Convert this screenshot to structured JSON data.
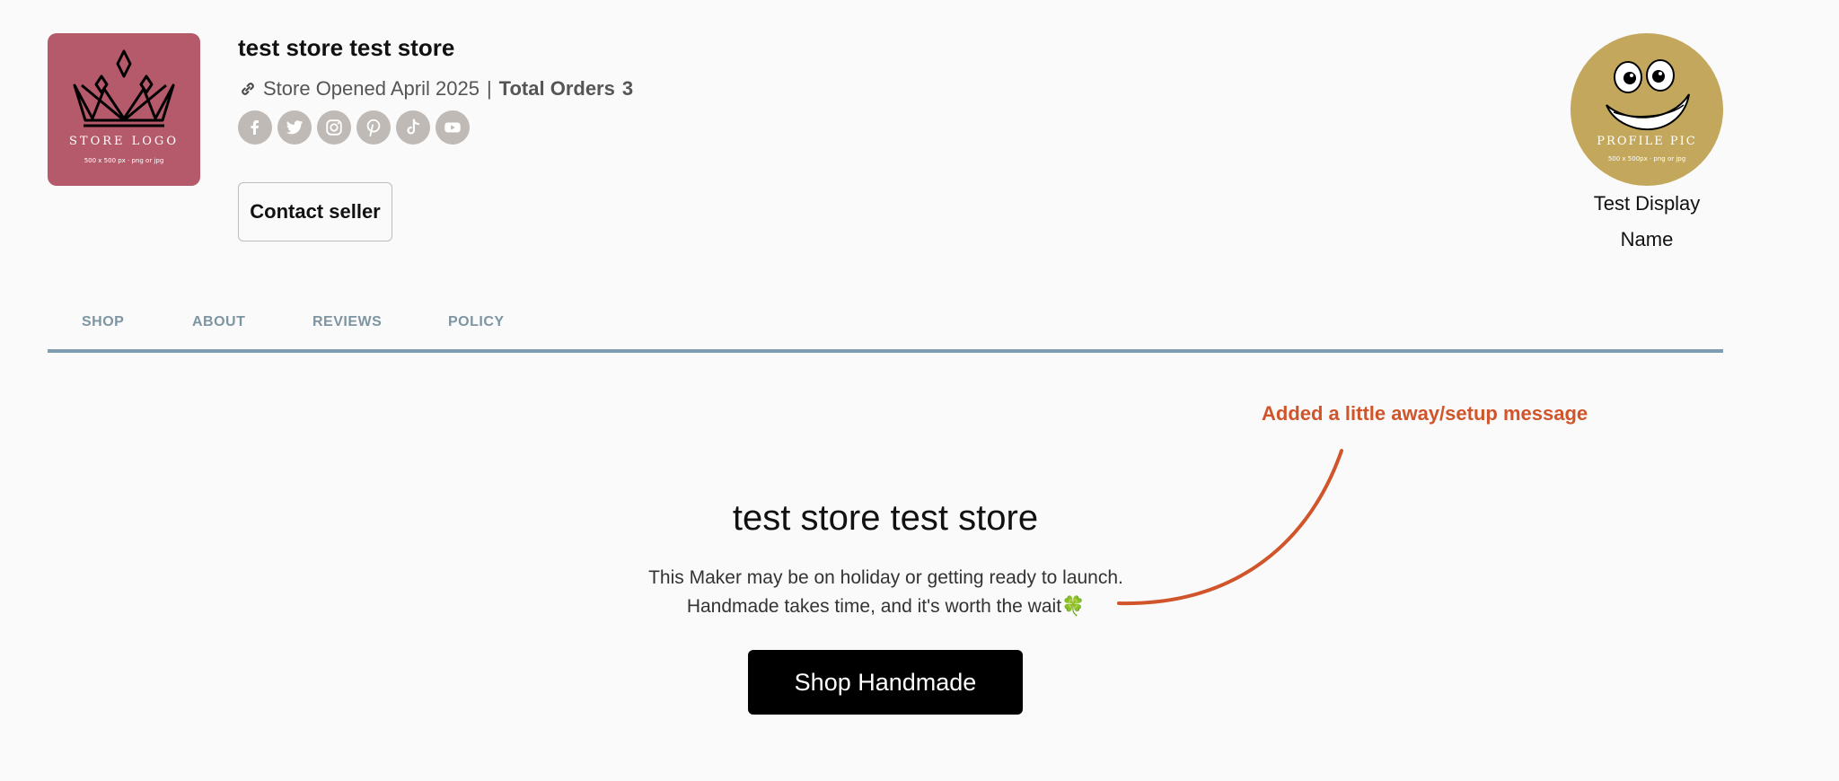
{
  "store": {
    "name": "test store test store",
    "opened": "Store Opened April 2025",
    "separator": "|",
    "orders_label": "Total Orders",
    "orders_count": "3",
    "logo_text": "STORE LOGO",
    "logo_subtext": "500 x 500 px · png or jpg"
  },
  "socials": [
    "facebook-icon",
    "twitter-icon",
    "instagram-icon",
    "pinterest-icon",
    "tiktok-icon",
    "youtube-icon"
  ],
  "contact_button": "Contact seller",
  "profile": {
    "pic_text": "PROFILE PIC",
    "pic_subtext": "500 x 500px · png or jpg",
    "display_name_line1": "Test Display",
    "display_name_line2": "Name"
  },
  "tabs": [
    "SHOP",
    "ABOUT",
    "REVIEWS",
    "POLICY"
  ],
  "annotation": "Added a little away/setup message",
  "main": {
    "title": "test store test store",
    "line1": "This Maker may be on holiday or getting ready to launch.",
    "line2": "Handmade takes time, and it's worth the wait",
    "line2_emoji": "🍀",
    "button": "Shop Handmade"
  },
  "colors": {
    "logo_bg": "#b55a6b",
    "profile_bg": "#c2a75c",
    "tab_text": "#7d95a3",
    "tab_rule": "#7e9db0",
    "annotation": "#d0552b"
  }
}
